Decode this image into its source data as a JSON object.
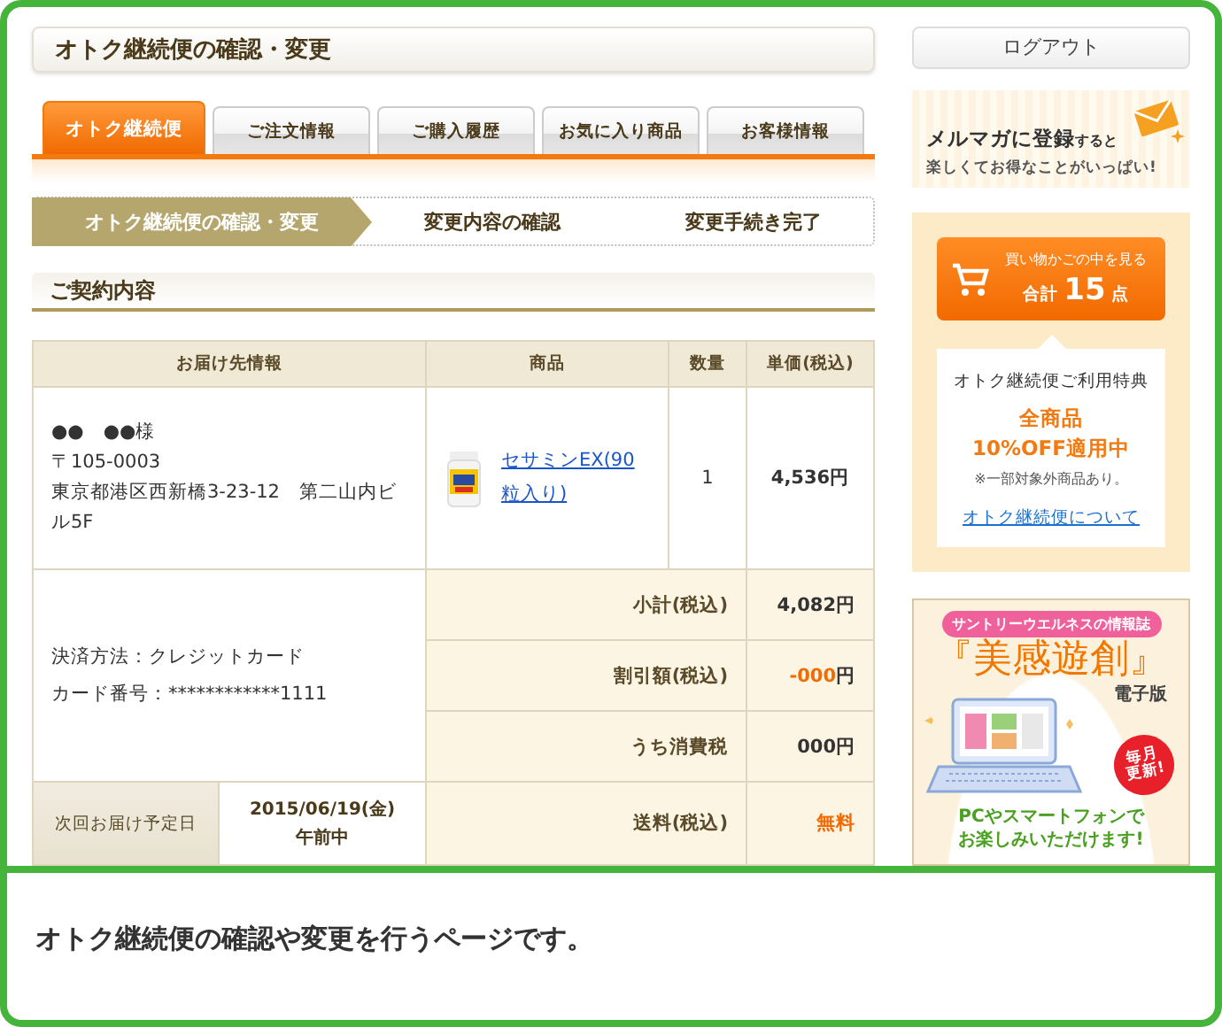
{
  "page_title": "オトク継続便の確認・変更",
  "tabs": [
    {
      "label": "オトク継続便",
      "selected": true
    },
    {
      "label": "ご注文情報",
      "selected": false
    },
    {
      "label": "ご購入履歴",
      "selected": false
    },
    {
      "label": "お気に入り商品",
      "selected": false
    },
    {
      "label": "お客様情報",
      "selected": false
    }
  ],
  "steps": [
    {
      "label": "オトク継続便の確認・変更",
      "selected": true
    },
    {
      "label": "変更内容の確認",
      "selected": false
    },
    {
      "label": "変更手続き完了",
      "selected": false
    }
  ],
  "section_title": "ご契約内容",
  "contract_table": {
    "columns": [
      "お届け先情報",
      "商品",
      "数量",
      "単価(税込)"
    ],
    "recipient": {
      "name": "●●　●●様",
      "postal": "〒105-0003",
      "address": "東京都港区西新橋3-23-12　第二山内ビル5F"
    },
    "product": {
      "kind": "picture",
      "name": "セサミンEX(90粒入り)",
      "quantity": "1",
      "unit_price": "4,536円"
    },
    "payment": [
      "決済方法：クレジットカード",
      "カード番号：************1111"
    ],
    "summary": [
      {
        "label": "小計(税込)",
        "value": "4,082",
        "unit": "円",
        "emphasis": false
      },
      {
        "label": "割引額(税込)",
        "value": "-000",
        "unit": "円",
        "emphasis": true
      },
      {
        "label": "うち消費税",
        "value": "000",
        "unit": "円",
        "emphasis": false
      },
      {
        "label": "送料(税込)",
        "value": "無料",
        "emphasis": true
      }
    ],
    "next_delivery": {
      "label": "次回お届け予定日",
      "date": "2015/06/19(金)",
      "time": "午前中"
    }
  },
  "sidebar": {
    "logout": "ログアウト",
    "newsletter": {
      "title": "**メルマガに登録**すると",
      "subtitle": "楽しくてお得なことがいっぱい!"
    },
    "cart": {
      "caption": "買い物かごの中を見る",
      "total": "合計 **15** 点"
    },
    "benefit": {
      "title": "オトク継続便ご利用特典",
      "offer": [
        "全商品",
        "10%OFF適用中"
      ],
      "note": "※一部対象外商品あり。",
      "link": "オトク継続便について"
    },
    "magazine": {
      "tag": "サントリーウエルネスの情報誌",
      "title": "『美感遊創』",
      "edition": "電子版",
      "badge": [
        "毎月",
        "更新!"
      ],
      "tagline": [
        "PCやスマートフォンで",
        "お楽しみいただけます!"
      ]
    }
  },
  "caption": "オトク継続便の確認や変更を行うページです。"
}
